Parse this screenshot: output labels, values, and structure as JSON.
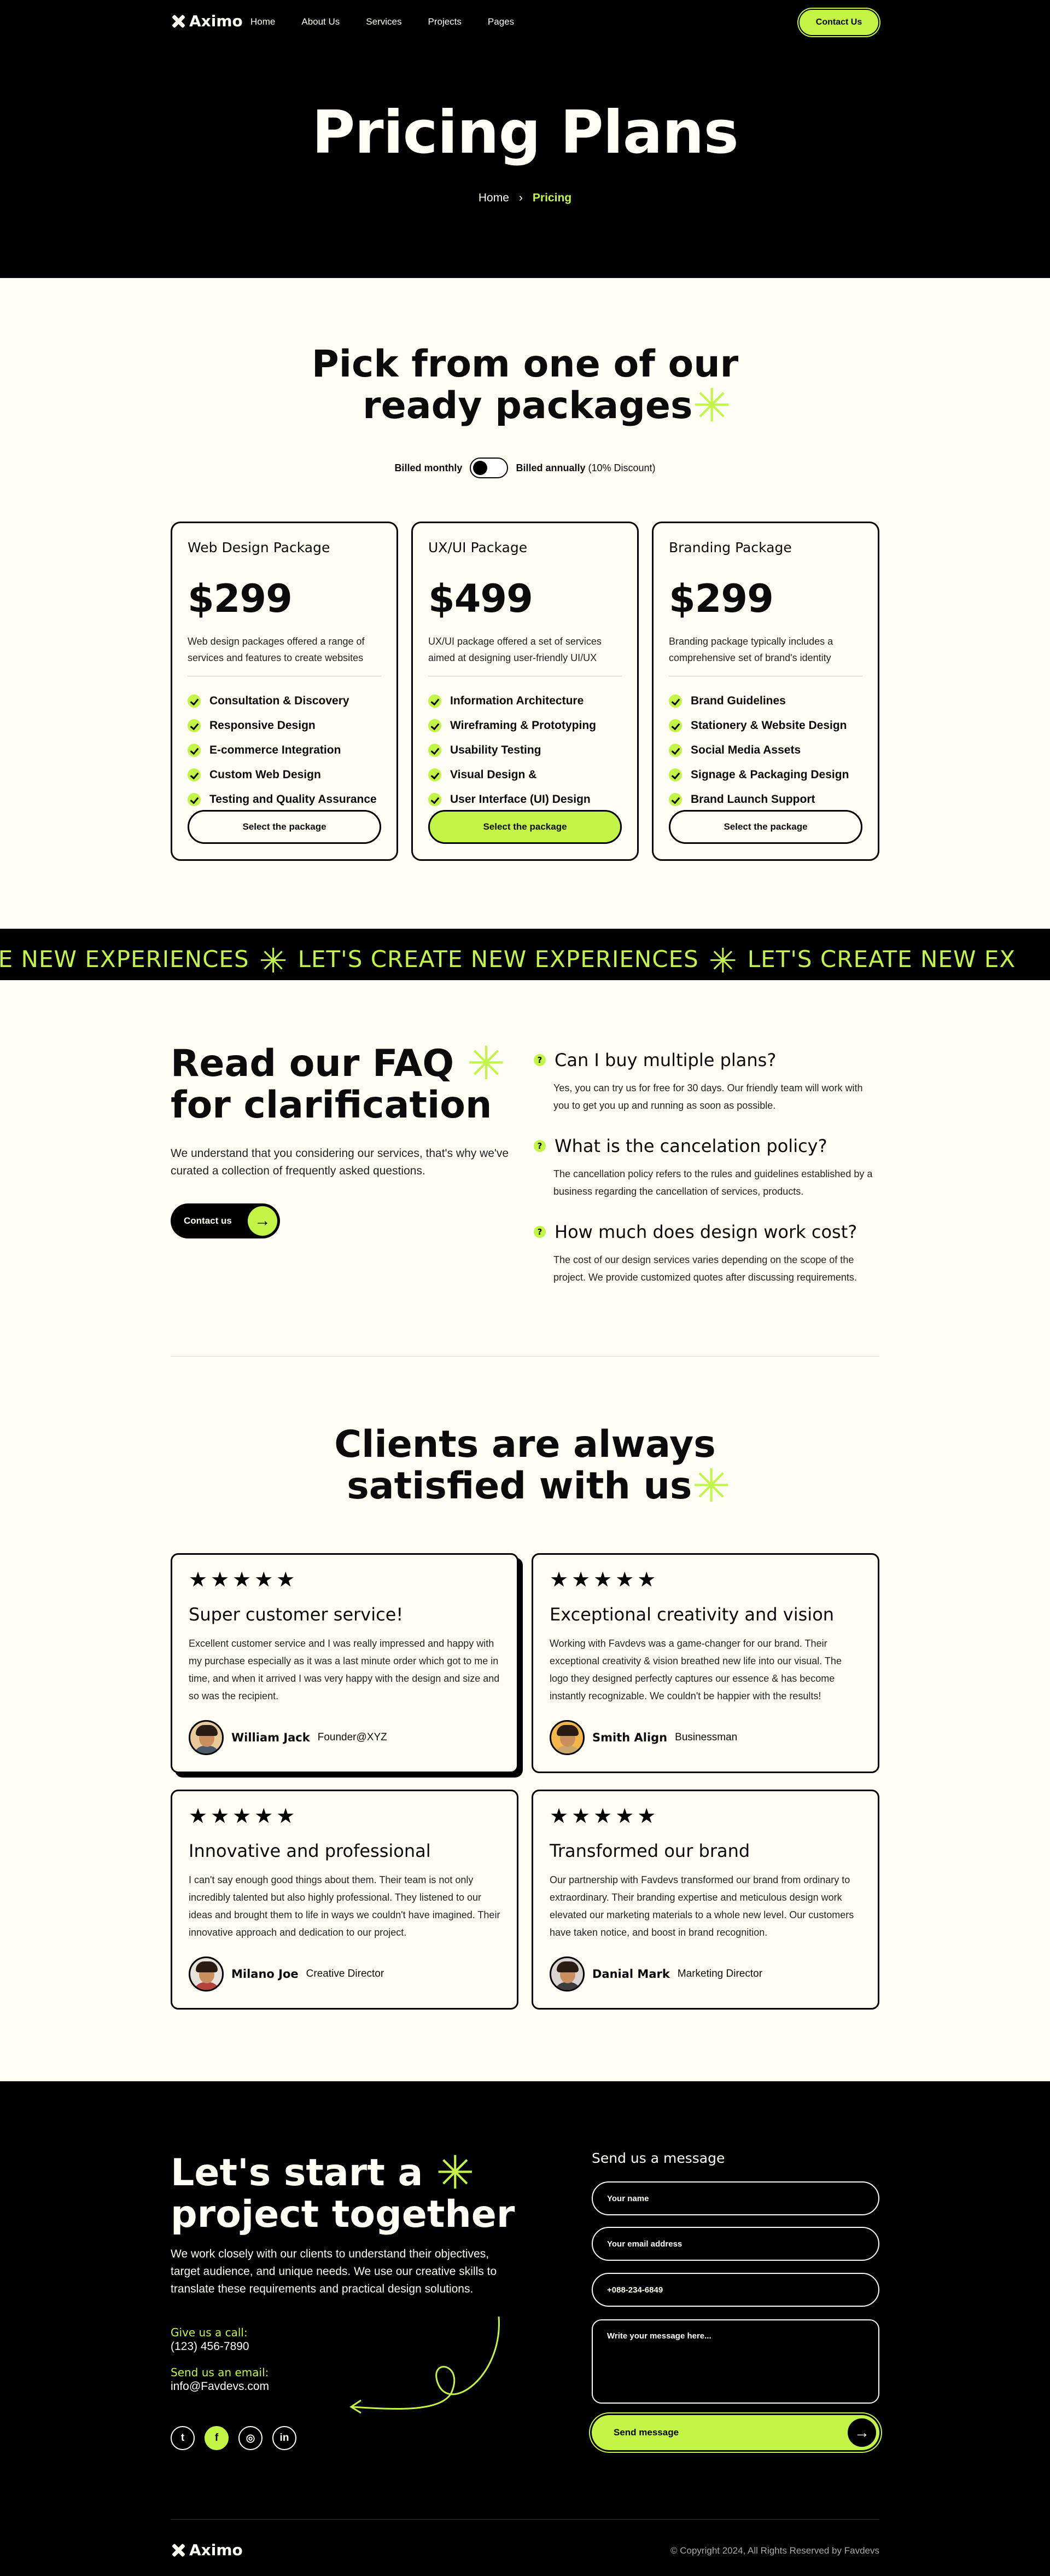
{
  "brand": "Aximo",
  "nav": {
    "links": [
      "Home",
      "About Us",
      "Services",
      "Projects",
      "Pages"
    ],
    "cta": "Contact Us"
  },
  "hero": {
    "title": "Pricing Plans",
    "breadcrumb_home": "Home",
    "breadcrumb_sep": "›",
    "breadcrumb_current": "Pricing"
  },
  "pricing": {
    "title_line1": "Pick from one of our",
    "title_line2": "ready packages",
    "accent_glyph": "✳",
    "billed_monthly": "Billed monthly",
    "billed_annually": "Billed annually",
    "discount": "(10% Discount)",
    "plans": [
      {
        "name": "Web Design Package",
        "price": "$299",
        "desc": "Web design packages offered a range of services and features to create websites",
        "features": [
          "Consultation & Discovery",
          "Responsive Design",
          "E-commerce Integration",
          "Custom Web Design",
          "Testing and Quality Assurance"
        ],
        "button": "Select the package"
      },
      {
        "name": "UX/UI Package",
        "price": "$499",
        "desc": "UX/UI package offered a set of services aimed at designing user-friendly UI/UX",
        "features": [
          "Information Architecture",
          "Wireframing & Prototyping",
          "Usability Testing",
          "Visual Design &",
          "User Interface (UI) Design"
        ],
        "button": "Select the package"
      },
      {
        "name": "Branding Package",
        "price": "$299",
        "desc": "Branding package typically includes a comprehensive set of brand's identity",
        "features": [
          "Brand Guidelines",
          "Stationery & Website Design",
          "Social Media Assets",
          "Signage & Packaging Design",
          "Brand Launch Support"
        ],
        "button": "Select the package"
      }
    ]
  },
  "marquee": {
    "items": [
      "EATE NEW EXPERIENCES",
      "LET'S CREATE NEW EXPERIENCES",
      "LET'S CREATE NEW EX"
    ]
  },
  "faq": {
    "title_line1": "Read our FAQ",
    "title_line2": "for clarification",
    "desc": "We understand that you considering our services, that's why we've curated a collection of frequently asked questions.",
    "button": "Contact us",
    "items": [
      {
        "q": "Can I buy multiple plans?",
        "a": "Yes, you can try us for free for 30 days. Our friendly team will work with you to get you up and running as soon as possible."
      },
      {
        "q": "What is the cancelation policy?",
        "a": "The cancellation policy refers to the rules and guidelines established by a business regarding the cancellation of services, products."
      },
      {
        "q": "How much does design work cost?",
        "a": "The cost of our design services varies depending on the scope of the project. We provide customized quotes after discussing requirements."
      }
    ]
  },
  "testimonials": {
    "title_line1": "Clients are always",
    "title_line2": "satisfied with us",
    "rating": 5,
    "items": [
      {
        "title": "Super customer service!",
        "text": "Excellent customer service and I was really impressed and happy with my purchase especially as it was a last minute order which got to me in time, and when it arrived I was very happy with the design and size and so was the recipient.",
        "name": "William Jack",
        "role": "Founder@XYZ"
      },
      {
        "title": "Exceptional creativity and vision",
        "text": "Working with Favdevs was a game-changer for our brand. Their exceptional creativity & vision breathed new life into our visual. The logo they designed perfectly captures our essence & has become instantly recognizable. We couldn't be happier with the results!",
        "name": "Smith Align",
        "role": "Businessman"
      },
      {
        "title": "Innovative and professional",
        "text": "I can't say enough good things about them. Their team is not only incredibly talented but also highly professional. They listened to our ideas and brought them to life in ways we couldn't have imagined. Their innovative approach and dedication to our project.",
        "name": "Milano Joe",
        "role": "Creative Director"
      },
      {
        "title": "Transformed our brand",
        "text": "Our partnership with Favdevs transformed our brand from ordinary to extraordinary. Their branding expertise and meticulous design work elevated our marketing materials to a whole new level. Our customers have taken notice, and boost in brand recognition.",
        "name": "Danial Mark",
        "role": "Marketing Director"
      }
    ]
  },
  "contact": {
    "title_line1": "Let's start a",
    "title_line2": "project together",
    "desc": "We work closely with our clients to understand their objectives, target audience, and unique needs. We use our creative skills to translate these requirements and practical design solutions.",
    "call_label": "Give us a call:",
    "phone": "(123) 456-7890",
    "email_label": "Send us an email:",
    "email": "info@Favdevs.com",
    "socials": [
      "twitter-icon",
      "facebook-icon",
      "instagram-icon",
      "linkedin-icon"
    ],
    "social_glyphs": [
      "t",
      "f",
      "◎",
      "in"
    ],
    "form_title": "Send us a message",
    "name_placeholder": "Your name",
    "email_placeholder": "Your email address",
    "phone_placeholder": "+088-234-6849",
    "message_placeholder": "Write your message here...",
    "send": "Send message"
  },
  "footer": {
    "copyright": "© Copyright 2024, All Rights Reserved by Favdevs"
  },
  "colors": {
    "accent": "#c3f546",
    "dark": "#000000",
    "light_bg": "#fdfdf4"
  }
}
